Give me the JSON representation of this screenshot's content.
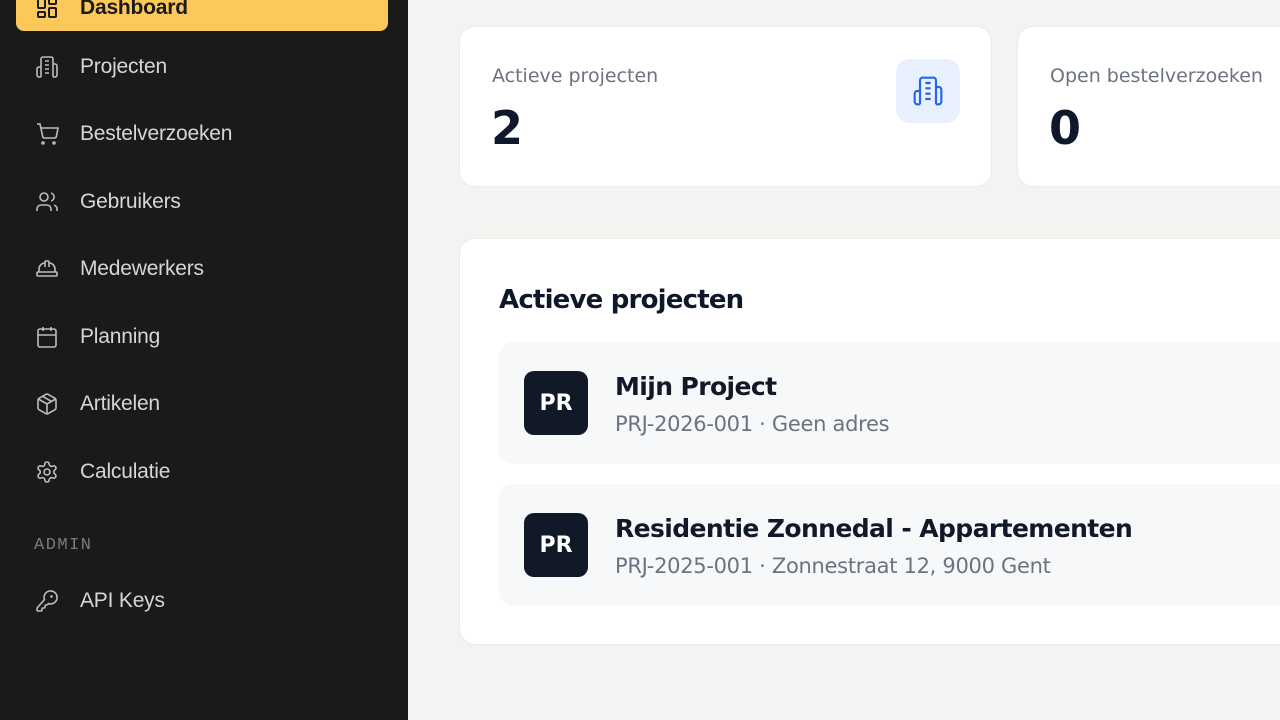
{
  "sidebar": {
    "items": [
      {
        "label": "Dashboard",
        "icon": "dashboard-icon",
        "active": true
      },
      {
        "label": "Projecten",
        "icon": "building-icon"
      },
      {
        "label": "Bestelverzoeken",
        "icon": "cart-icon"
      },
      {
        "label": "Gebruikers",
        "icon": "users-icon"
      },
      {
        "label": "Medewerkers",
        "icon": "hard-hat-icon"
      },
      {
        "label": "Planning",
        "icon": "calendar-icon"
      },
      {
        "label": "Artikelen",
        "icon": "package-icon"
      },
      {
        "label": "Calculatie",
        "icon": "gear-icon"
      }
    ],
    "admin_section_label": "ADMIN",
    "admin_items": [
      {
        "label": "API Keys",
        "icon": "key-icon"
      }
    ]
  },
  "stats": [
    {
      "title": "Actieve projecten",
      "value": "2",
      "icon": "building-icon"
    },
    {
      "title": "Open bestelverzoeken",
      "value": "0"
    }
  ],
  "projects": {
    "title": "Actieve projecten",
    "items": [
      {
        "initials": "PR",
        "name": "Mijn Project",
        "meta": "PRJ-2026-001 · Geen adres"
      },
      {
        "initials": "PR",
        "name": "Residentie Zonnedal - Appartementen",
        "meta": "PRJ-2025-001 · Zonnestraat 12, 9000 Gent"
      }
    ]
  },
  "colors": {
    "sidebar_bg": "#1a1a1a",
    "accent": "#fbc859",
    "page_bg": "#f4f3f1",
    "icon_blue": "#2563eb"
  }
}
